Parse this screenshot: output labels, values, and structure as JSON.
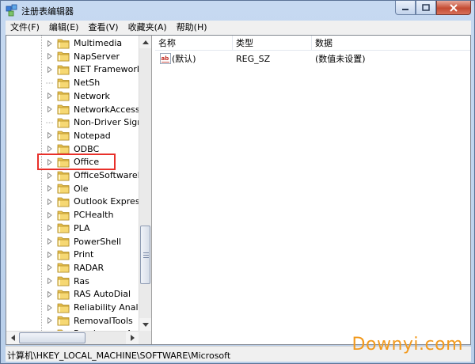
{
  "window": {
    "title": "注册表编辑器",
    "icon": "registry-editor-icon"
  },
  "menu": [
    "文件(F)",
    "编辑(E)",
    "查看(V)",
    "收藏夹(A)",
    "帮助(H)"
  ],
  "tree": {
    "items": [
      {
        "label": "Multimedia",
        "expandable": true
      },
      {
        "label": "NapServer",
        "expandable": true
      },
      {
        "label": "NET Framework S",
        "expandable": true
      },
      {
        "label": "NetSh",
        "expandable": false
      },
      {
        "label": "Network",
        "expandable": true
      },
      {
        "label": "NetworkAccessPr",
        "expandable": true
      },
      {
        "label": "Non-Driver Signin",
        "expandable": false
      },
      {
        "label": "Notepad",
        "expandable": true
      },
      {
        "label": "ODBC",
        "expandable": true
      },
      {
        "label": "Office",
        "expandable": true,
        "highlighted": true
      },
      {
        "label": "OfficeSoftwarePro",
        "expandable": true
      },
      {
        "label": "Ole",
        "expandable": true
      },
      {
        "label": "Outlook Express",
        "expandable": true
      },
      {
        "label": "PCHealth",
        "expandable": true
      },
      {
        "label": "PLA",
        "expandable": true
      },
      {
        "label": "PowerShell",
        "expandable": true
      },
      {
        "label": "Print",
        "expandable": true
      },
      {
        "label": "RADAR",
        "expandable": true
      },
      {
        "label": "Ras",
        "expandable": true
      },
      {
        "label": "RAS AutoDial",
        "expandable": true
      },
      {
        "label": "Reliability Analysis",
        "expandable": true
      },
      {
        "label": "RemovalTools",
        "expandable": true
      },
      {
        "label": "RendezvousApps",
        "expandable": true
      }
    ]
  },
  "list": {
    "columns": [
      "名称",
      "类型",
      "数据"
    ],
    "rows": [
      {
        "name": "(默认)",
        "type": "REG_SZ",
        "data": "(数值未设置)",
        "icon": "string-value-icon"
      }
    ]
  },
  "status": {
    "path": "计算机\\HKEY_LOCAL_MACHINE\\SOFTWARE\\Microsoft"
  },
  "watermark": "Downyi.com",
  "colors": {
    "highlight_border": "#e8302a",
    "watermark": "#f29a1e"
  }
}
